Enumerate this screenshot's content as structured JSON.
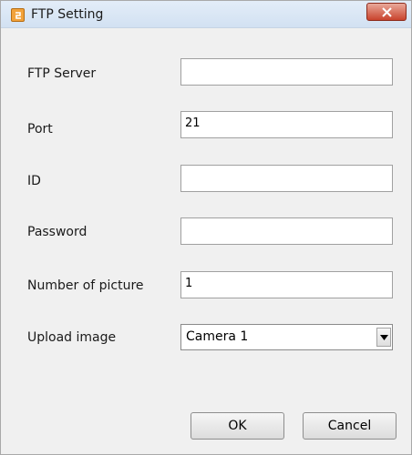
{
  "window": {
    "title": "FTP Setting"
  },
  "icons": {
    "app": "ftp-app-icon",
    "close": "close-icon",
    "dropdown": "chevron-down-icon"
  },
  "colors": {
    "close_button": "#c9432d",
    "app_icon": "#f2a23a"
  },
  "form": {
    "ftp_server": {
      "label": "FTP Server",
      "value": ""
    },
    "port": {
      "label": "Port",
      "value": "21"
    },
    "id": {
      "label": "ID",
      "value": ""
    },
    "password": {
      "label": "Password",
      "value": ""
    },
    "number_of_picture": {
      "label": "Number of picture",
      "value": "1"
    },
    "upload_image": {
      "label": "Upload image",
      "selected": "Camera 1"
    }
  },
  "buttons": {
    "ok": "OK",
    "cancel": "Cancel"
  }
}
